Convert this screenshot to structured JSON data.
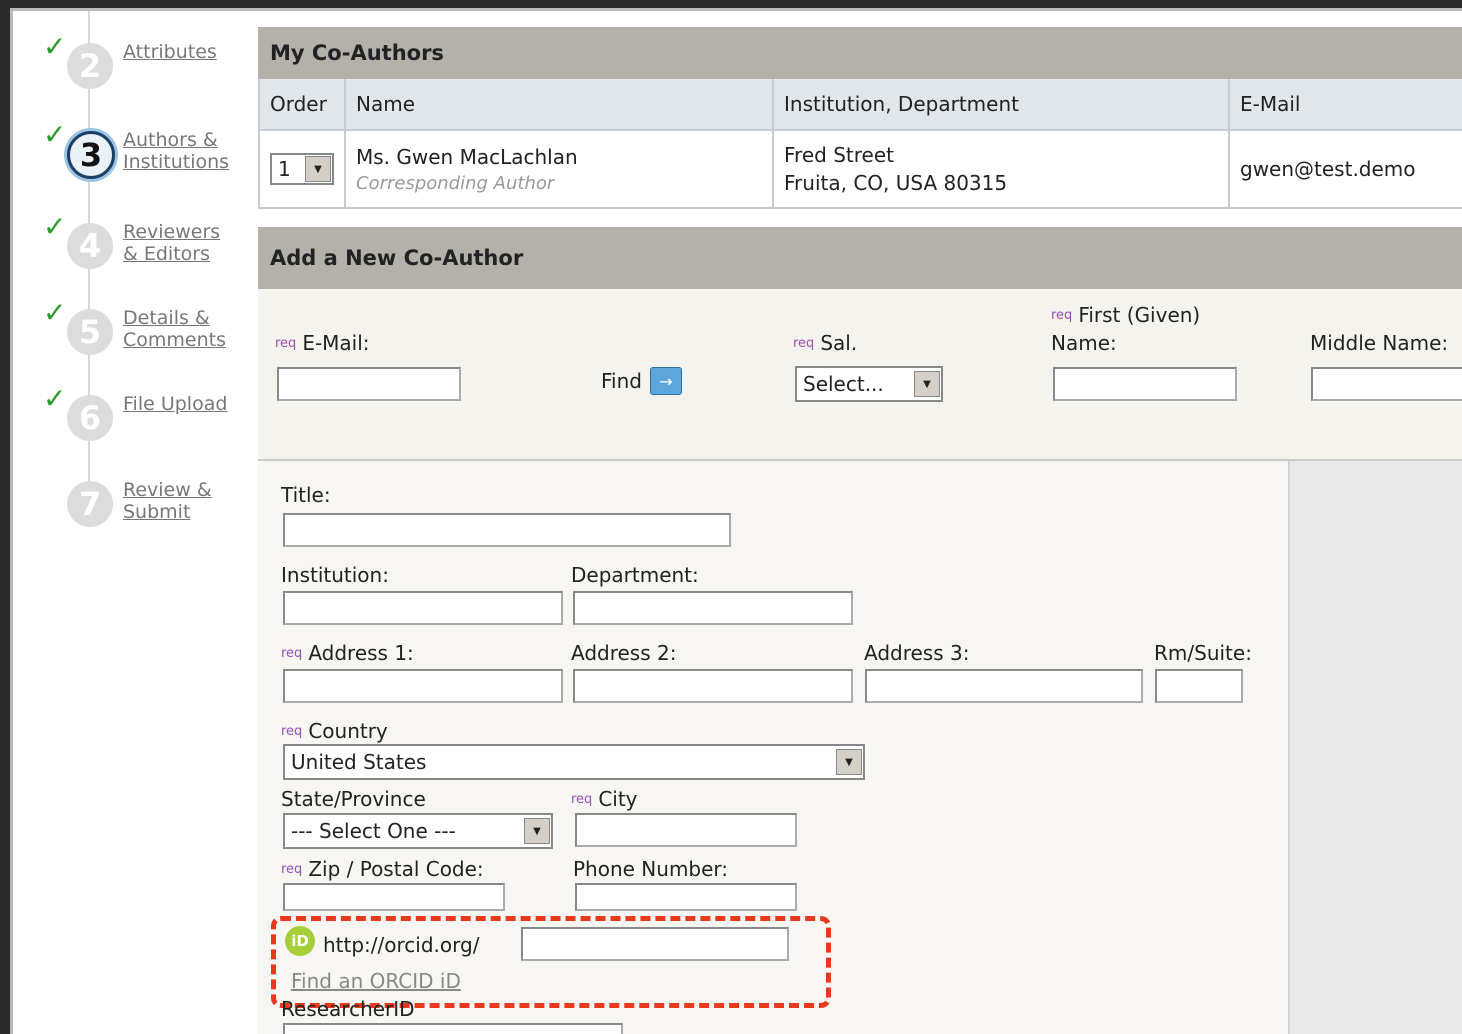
{
  "steps": [
    {
      "num": "2",
      "label": "Attributes"
    },
    {
      "num": "3",
      "label": "Authors & Institutions"
    },
    {
      "num": "4",
      "label": "Reviewers & Editors"
    },
    {
      "num": "5",
      "label": "Details & Comments"
    },
    {
      "num": "6",
      "label": "File Upload"
    },
    {
      "num": "7",
      "label": "Review & Submit"
    }
  ],
  "check": "✓",
  "coauthors": {
    "title": "My Co-Authors",
    "columns": [
      "Order",
      "Name",
      "Institution, Department",
      "E-Mail"
    ],
    "row": {
      "order": "1",
      "name": "Ms. Gwen MacLachlan",
      "role": "Corresponding Author",
      "inst_line1": "Fred Street",
      "inst_line2": "Fruita, CO, USA 80315",
      "email": "gwen@test.demo"
    }
  },
  "add": {
    "title": "Add a New Co-Author",
    "req": "req",
    "email_label": "E-Mail:",
    "find_label": "Find",
    "find_arrow": "→",
    "sal_label": "Sal.",
    "sal_value": "Select...",
    "first_label_1": "First (Given)",
    "first_label_2": "Name:",
    "middle_label": "Middle Name:",
    "title_label": "Title:",
    "institution_label": "Institution:",
    "department_label": "Department:",
    "address1_label": "Address 1:",
    "address2_label": "Address 2:",
    "address3_label": "Address 3:",
    "suite_label": "Rm/Suite:",
    "country_label": "Country",
    "country_value": "United States",
    "state_label": "State/Province",
    "state_value": "--- Select One ---",
    "city_label": "City",
    "zip_label": "Zip / Postal Code:",
    "phone_label": "Phone Number:",
    "orcid_icon": "iD",
    "orcid_prefix": "http://orcid.org/",
    "orcid_link": "Find an ORCID iD",
    "researcher_label": "ResearcherID"
  },
  "colors": {
    "accent_box": "#e8391d",
    "orcid_green": "#a6ce39",
    "check_green": "#2e9a2e"
  }
}
